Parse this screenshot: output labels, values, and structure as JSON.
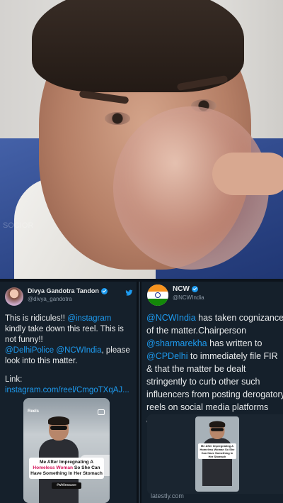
{
  "video": {
    "watermark": "SOCIOR"
  },
  "left_tweet": {
    "name": "Divya Gandotra Tandon",
    "handle": "@divya_gandotra",
    "para1_a": "This is ridicules!! ",
    "para1_mention1": "@instagram",
    "para1_b": " kindly take down this reel. This is not funny!!",
    "para1_mention2": "@DelhiPolice",
    "para1_mention3": "@NCWIndia",
    "para1_c": ", please look into this matter.",
    "para2_label": "Link: ",
    "para2_link": "instagram.com/reel/CmgoTXqAJ...",
    "media": {
      "reels_label": "Reels",
      "caption_a": "Me After Impregnating A ",
      "caption_hl": "Homeless Woman",
      "caption_b": " So She Can Have Something In Her Stomach",
      "tag": "#whitesauce"
    }
  },
  "right_tweet": {
    "name": "NCW",
    "handle": "@NCWIndia",
    "mention1": "@NCWIndia",
    "text_a": " has taken cognizance of the matter.Chairperson ",
    "mention2": "@sharmarekha",
    "text_b": " has written to ",
    "mention3": "@CPDelhi",
    "text_c": " to immediately file FIR & that the matter be dealt stringently to curb other such influencers from posting derogatory reels on social media platforms about women.",
    "media": {
      "caption": "Me After Impregnating A Homeless Woman So She Can Have Something In Her Stomach"
    },
    "source": "latestly.com"
  },
  "colors": {
    "background": "#15202b",
    "link": "#1d9bf0",
    "verified": "#1d9bf0",
    "muted": "#8b98a5"
  },
  "icons": [
    "twitter-bird-icon",
    "verified-badge-icon",
    "camera-icon"
  ]
}
